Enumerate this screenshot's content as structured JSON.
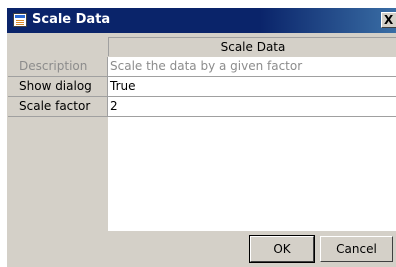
{
  "window": {
    "title": "Scale Data",
    "close_glyph": "X"
  },
  "grid": {
    "header": "Scale Data",
    "rows": [
      {
        "label": "Description",
        "value": "Scale the data by a given factor",
        "disabled": true
      },
      {
        "label": "Show dialog",
        "value": "True",
        "disabled": false
      },
      {
        "label": "Scale factor",
        "value": "2",
        "disabled": false
      }
    ]
  },
  "buttons": {
    "ok": "OK",
    "cancel": "Cancel"
  },
  "icons": {
    "app": "scale-data-app-icon",
    "close": "close-icon"
  },
  "colors": {
    "titlebar": "#0a246a",
    "dialog_face": "#d4d0c8",
    "disabled_text": "#8c8c8c"
  }
}
